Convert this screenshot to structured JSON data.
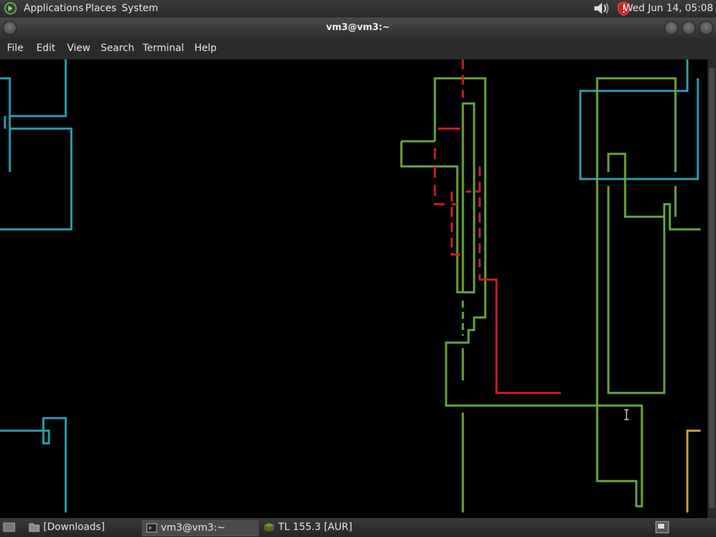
{
  "top_panel": {
    "menus": [
      "Applications",
      "Places",
      "System"
    ],
    "clock": "Wed Jun 14, 05:08",
    "icons": [
      "gnome-foot-icon",
      "volume-icon",
      "security-shield-icon"
    ]
  },
  "window": {
    "title": "vm3@vm3:~",
    "menu": [
      "File",
      "Edit",
      "View",
      "Search",
      "Terminal",
      "Help"
    ]
  },
  "terminal": {
    "content": "pipes screensaver",
    "colors": {
      "blue": "#2aa0b0",
      "green": "#6aa83a",
      "red": "#cc1f1f",
      "yellow": "#d4a53a"
    }
  },
  "taskbar": {
    "tasks": [
      {
        "label": "[Downloads]",
        "icon": "folder-icon",
        "active": false
      },
      {
        "label": "vm3@vm3:~",
        "icon": "terminal-icon",
        "active": true
      },
      {
        "label": "TL 155.3 [AUR]",
        "icon": "minecraft-block-icon",
        "active": false
      }
    ]
  }
}
